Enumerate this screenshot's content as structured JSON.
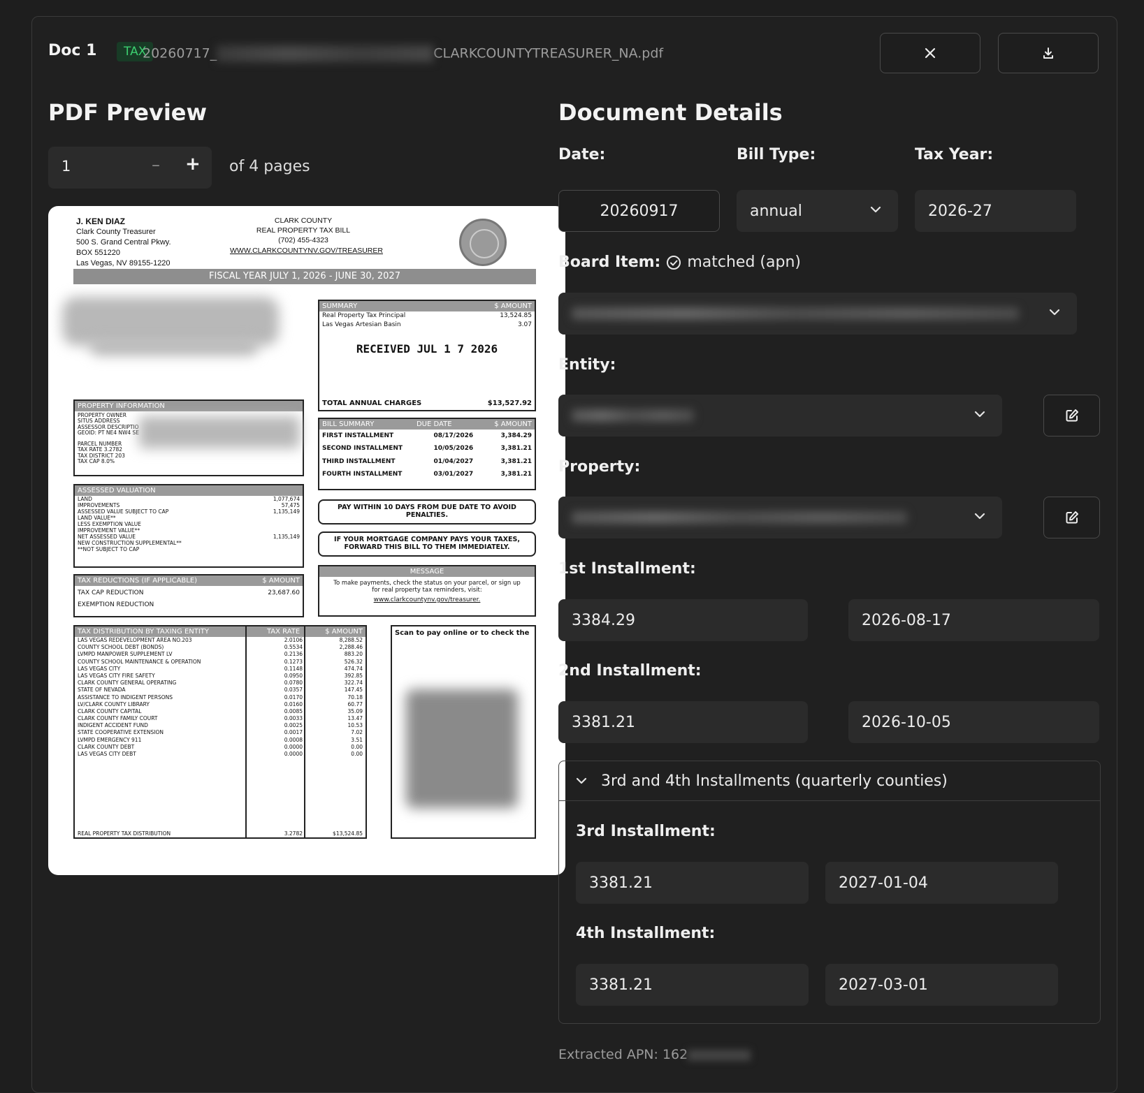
{
  "header": {
    "doc_label": "Doc 1",
    "badge": "TAX",
    "filename_start": "20260717_",
    "filename_end": "CLARKCOUNTYTREASURER_NA.pdf"
  },
  "preview": {
    "title": "PDF Preview",
    "page_value": "1",
    "minus": "–",
    "plus": "+",
    "of_pages": "of 4 pages",
    "bill": {
      "treasurer_name": "J. KEN DIAZ",
      "treasurer_title": "Clark County Treasurer",
      "addr1": "500 S. Grand Central Pkwy.",
      "addr2": "BOX 551220",
      "addr3": "Las Vegas, NV 89155-1220",
      "county": "CLARK COUNTY",
      "bill_title": "REAL PROPERTY TAX BILL",
      "phone": "(702) 455-4323",
      "web": "WWW.CLARKCOUNTYNV.GOV/TREASURER",
      "fiscal_year": "FISCAL YEAR JULY 1, 2026 - JUNE 30, 2027",
      "summary_head": "SUMMARY",
      "amount_head": "$ AMOUNT",
      "summary_rows": [
        {
          "label": "Real Property Tax Principal",
          "value": "13,524.85"
        },
        {
          "label": "Las Vegas Artesian Basin",
          "value": "3.07"
        }
      ],
      "received_stamp": "RECEIVED  JUL 1 7 2026",
      "total_label": "TOTAL ANNUAL CHARGES",
      "total_value": "$13,527.92",
      "bill_summary_head": "BILL SUMMARY",
      "due_date_head": "DUE DATE",
      "installments": [
        {
          "label": "FIRST INSTALLMENT",
          "date": "08/17/2026",
          "amount": "3,384.29"
        },
        {
          "label": "SECOND INSTALLMENT",
          "date": "10/05/2026",
          "amount": "3,381.21"
        },
        {
          "label": "THIRD INSTALLMENT",
          "date": "01/04/2027",
          "amount": "3,381.21"
        },
        {
          "label": "FOURTH INSTALLMENT",
          "date": "03/01/2027",
          "amount": "3,381.21"
        }
      ],
      "notice1": "PAY WITHIN 10 DAYS FROM DUE DATE TO AVOID PENALTIES.",
      "notice2": "IF YOUR MORTGAGE COMPANY PAYS YOUR TAXES, FORWARD THIS BILL TO THEM IMMEDIATELY.",
      "message_head": "MESSAGE",
      "message_text": "To make payments, check the status on your parcel, or sign up for real property tax reminders, visit:",
      "message_link": "www.clarkcountynv.gov/treasurer.",
      "property_info_head": "PROPERTY INFORMATION",
      "property_info_rows": [
        "PROPERTY OWNER",
        "SITUS ADDRESS",
        "ASSESSOR DESCRIPTIO",
        "GEOID: PT NE4 NW4 SE",
        "",
        "PARCEL NUMBER",
        "TAX RATE   3.2782",
        "TAX DISTRICT   203",
        "TAX CAP   8.0%"
      ],
      "assessed_head": "ASSESSED VALUATION",
      "assessed_rows": [
        {
          "label": "LAND",
          "value": "1,077,674"
        },
        {
          "label": "IMPROVEMENTS",
          "value": "57,475"
        },
        {
          "label": "ASSESSED VALUE SUBJECT TO CAP",
          "value": "1,135,149"
        },
        {
          "label": "LAND VALUE**",
          "value": ""
        },
        {
          "label": "LESS EXEMPTION VALUE",
          "value": ""
        },
        {
          "label": "IMPROVEMENT VALUE**",
          "value": ""
        },
        {
          "label": "NET ASSESSED VALUE",
          "value": "1,135,149"
        },
        {
          "label": "NEW CONSTRUCTION SUPPLEMENTAL**",
          "value": ""
        },
        {
          "label": "**NOT SUBJECT TO CAP",
          "value": ""
        }
      ],
      "reductions_head": "TAX REDUCTIONS (IF APPLICABLE)",
      "reductions_rows": [
        {
          "label": "TAX CAP REDUCTION",
          "value": "23,687.60"
        },
        {
          "label": "EXEMPTION REDUCTION",
          "value": ""
        }
      ],
      "dist_head": "TAX DISTRIBUTION BY TAXING ENTITY",
      "rate_head": "TAX RATE",
      "dist_rows": [
        {
          "label": "LAS VEGAS REDEVELOPMENT AREA NO.203",
          "rate": "2.0106",
          "amount": "8,288.52"
        },
        {
          "label": "COUNTY SCHOOL DEBT (BONDS)",
          "rate": "0.5534",
          "amount": "2,288.46"
        },
        {
          "label": "LVMPD MANPOWER SUPPLEMENT LV",
          "rate": "0.2136",
          "amount": "883.20"
        },
        {
          "label": "COUNTY SCHOOL MAINTENANCE & OPERATION",
          "rate": "0.1273",
          "amount": "526.32"
        },
        {
          "label": "LAS VEGAS CITY",
          "rate": "0.1148",
          "amount": "474.74"
        },
        {
          "label": "LAS VEGAS CITY FIRE SAFETY",
          "rate": "0.0950",
          "amount": "392.85"
        },
        {
          "label": "CLARK COUNTY GENERAL OPERATING",
          "rate": "0.0780",
          "amount": "322.74"
        },
        {
          "label": "STATE OF NEVADA",
          "rate": "0.0357",
          "amount": "147.45"
        },
        {
          "label": "ASSISTANCE TO INDIGENT PERSONS",
          "rate": "0.0170",
          "amount": "70.18"
        },
        {
          "label": "LV/CLARK COUNTY LIBRARY",
          "rate": "0.0160",
          "amount": "60.77"
        },
        {
          "label": "CLARK COUNTY CAPITAL",
          "rate": "0.0085",
          "amount": "35.09"
        },
        {
          "label": "CLARK COUNTY FAMILY COURT",
          "rate": "0.0033",
          "amount": "13.47"
        },
        {
          "label": "INDIGENT ACCIDENT FUND",
          "rate": "0.0025",
          "amount": "10.53"
        },
        {
          "label": "STATE COOPERATIVE EXTENSION",
          "rate": "0.0017",
          "amount": "7.02"
        },
        {
          "label": "LVMPD EMERGENCY 911",
          "rate": "0.0008",
          "amount": "3.51"
        },
        {
          "label": "CLARK COUNTY DEBT",
          "rate": "0.0000",
          "amount": "0.00"
        },
        {
          "label": "LAS VEGAS CITY DEBT",
          "rate": "0.0000",
          "amount": "0.00"
        }
      ],
      "dist_total_label": "REAL PROPERTY TAX DISTRIBUTION",
      "dist_total_rate": "3.2782",
      "dist_total_amount": "$13,524.85",
      "scan_text": "Scan to pay online or to check the"
    }
  },
  "details": {
    "title": "Document Details",
    "date_label": "Date:",
    "date_value": "20260917",
    "bill_type_label": "Bill Type:",
    "bill_type_value": "annual",
    "tax_year_label": "Tax Year:",
    "tax_year_value": "2026-27",
    "board_item_label": "Board Item:",
    "board_item_status": "matched (apn)",
    "entity_label": "Entity:",
    "property_label": "Property:",
    "inst1_label": "1st Installment:",
    "inst1_amount": "3384.29",
    "inst1_date": "2026-08-17",
    "inst2_label": "2nd Installment:",
    "inst2_amount": "3381.21",
    "inst2_date": "2026-10-05",
    "expander_label": "3rd and 4th Installments (quarterly counties)",
    "inst3_label": "3rd Installment:",
    "inst3_amount": "3381.21",
    "inst3_date": "2027-01-04",
    "inst4_label": "4th Installment:",
    "inst4_amount": "3381.21",
    "inst4_date": "2027-03-01",
    "extracted_apn": "Extracted APN: 162"
  }
}
